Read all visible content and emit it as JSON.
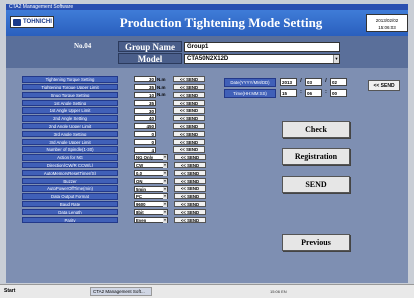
{
  "os_title": "CTA2 Management Software",
  "brand": {
    "logo_text": "TOHNICHI"
  },
  "title": "Production Tightening Mode Setting",
  "clock": {
    "date": "2013/02/02",
    "time": "15:06:03"
  },
  "header": {
    "no_label": "No.04",
    "group_label": "Group Name",
    "group_value": "Group1",
    "model_label": "Model",
    "model_value": "CTA50N2X12D"
  },
  "send_label": "<< SEND",
  "params": [
    {
      "label": "Tightening Torque Setting",
      "value": "30",
      "unit": "N.m",
      "type": "num"
    },
    {
      "label": "Tightening Torque Upper Limit",
      "value": "35",
      "unit": "N.m",
      "type": "num"
    },
    {
      "label": "Snug Torque Setting",
      "value": "10",
      "unit": "N.m",
      "type": "num"
    },
    {
      "label": "1st Angle Setting",
      "value": "35",
      "unit": "",
      "type": "num"
    },
    {
      "label": "1st Angle Upper Limit",
      "value": "30",
      "unit": "",
      "type": "num"
    },
    {
      "label": "2nd Angle Setting",
      "value": "40",
      "unit": "",
      "type": "num"
    },
    {
      "label": "2nd Angle Upper Limit",
      "value": "450",
      "unit": "",
      "type": "num"
    },
    {
      "label": "3rd Angle Setting",
      "value": "0",
      "unit": "",
      "type": "num"
    },
    {
      "label": "3rd Angle Upper Limit",
      "value": "0",
      "unit": "",
      "type": "num"
    },
    {
      "label": "Number of Spindle(1-30)",
      "value": "4",
      "unit": "",
      "type": "num"
    },
    {
      "label": "Action for NG",
      "value": "NG Only",
      "unit": "",
      "type": "select"
    },
    {
      "label": "Direction(CW/R CCW/L)",
      "value": "CW",
      "unit": "",
      "type": "select"
    },
    {
      "label": "AutoMemoryResetTimer(S)",
      "value": "0.0",
      "unit": "",
      "type": "select"
    },
    {
      "label": "Buzzer",
      "value": "ON",
      "unit": "",
      "type": "select"
    },
    {
      "label": "AutoPowerOffTime(min)",
      "value": "5min",
      "unit": "",
      "type": "select"
    },
    {
      "label": "Data Output Format",
      "value": "PC",
      "unit": "",
      "type": "select"
    },
    {
      "label": "Baud Rate",
      "value": "9600",
      "unit": "",
      "type": "select"
    },
    {
      "label": "Data Length",
      "value": "8bit",
      "unit": "",
      "type": "select"
    },
    {
      "label": "Parity",
      "value": "Even",
      "unit": "",
      "type": "select"
    }
  ],
  "datetime": {
    "date_label": "Date(YYYY/MM/DD)",
    "time_label": "Time(HH:MM:SS)",
    "year": "2013",
    "month": "03",
    "day": "02",
    "hour": "15",
    "minute": "06",
    "second": "00",
    "send_label": "<< SEND"
  },
  "buttons": {
    "check": "Check",
    "registration": "Registration",
    "send": "SEND",
    "previous": "Previous"
  },
  "taskbar": {
    "start": "Start",
    "task": "CTA2 Management Soft...",
    "tray": "15:06 EN"
  }
}
